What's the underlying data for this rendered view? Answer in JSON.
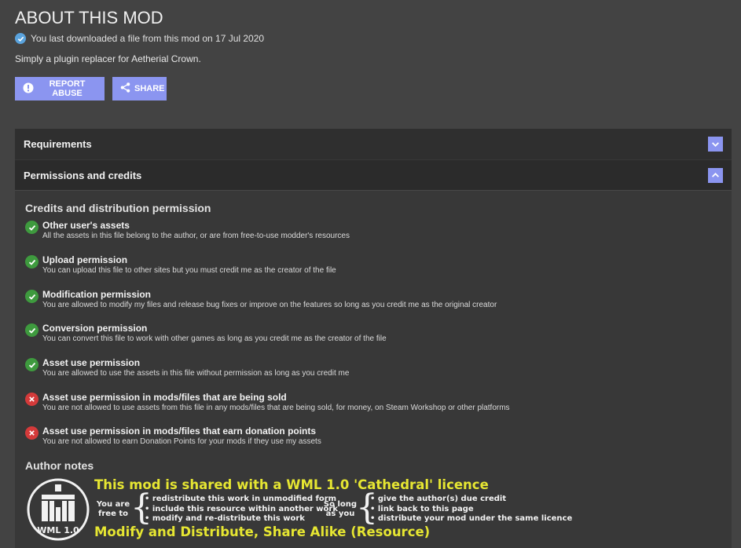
{
  "header": {
    "title": "ABOUT THIS MOD",
    "download_notice": "You last downloaded a file from this mod on 17 Jul 2020",
    "description": "Simply a plugin replacer for Aetherial Crown."
  },
  "buttons": {
    "report": "REPORT ABUSE",
    "share": "SHARE"
  },
  "accordion": {
    "requirements": "Requirements",
    "permissions": "Permissions and credits"
  },
  "permissions": {
    "heading": "Credits and distribution permission",
    "items": [
      {
        "title": "Other user's assets",
        "desc": "All the assets in this file belong to the author, or are from free-to-use modder's resources",
        "allowed": true
      },
      {
        "title": "Upload permission",
        "desc": "You can upload this file to other sites but you must credit me as the creator of the file",
        "allowed": true
      },
      {
        "title": "Modification permission",
        "desc": "You are allowed to modify my files and release bug fixes or improve on the features so long as you credit me as the original creator",
        "allowed": true
      },
      {
        "title": "Conversion permission",
        "desc": "You can convert this file to work with other games as long as you credit me as the creator of the file",
        "allowed": true
      },
      {
        "title": "Asset use permission",
        "desc": "You are allowed to use the assets in this file without permission as long as you credit me",
        "allowed": true
      },
      {
        "title": "Asset use permission in mods/files that are being sold",
        "desc": "You are not allowed to use assets from this file in any mods/files that are being sold, for money, on Steam Workshop or other platforms",
        "allowed": false
      },
      {
        "title": "Asset use permission in mods/files that earn donation points",
        "desc": "You are not allowed to earn Donation Points for your mods if they use my assets",
        "allowed": false
      }
    ]
  },
  "author_notes": {
    "heading": "Author notes",
    "licence": {
      "logo_text": "WML 1.0",
      "headline": "This mod is shared with a WML 1.0 'Cathedral' licence",
      "free_label_1": "You are",
      "free_label_2": "free to",
      "free_items": [
        "redistribute this work in unmodified form",
        "include this resource within another work",
        "modify and re-distribute this work"
      ],
      "long_label_1": "So long",
      "long_label_2": "as you",
      "long_items": [
        "give the author(s) due credit",
        "link back to this page",
        "distribute your mod under the same licence"
      ],
      "footer": "Modify and Distribute, Share Alike (Resource)"
    }
  },
  "colors": {
    "accent": "#8b95f0",
    "allowed": "#3e9a3e",
    "denied": "#d43a3a",
    "licence_text": "#e6e632"
  }
}
